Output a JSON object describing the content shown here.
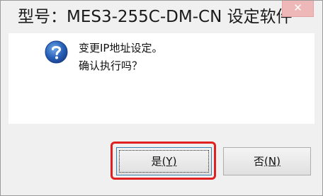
{
  "dialog": {
    "title": "型号：MES3-255C-DM-CN 设定软件",
    "close_glyph": "✕",
    "icon": "question-icon",
    "message_line1": "变更IP地址设定。",
    "message_line2": "确认执行吗？",
    "yes_label": "是",
    "yes_hotkey": "(Y)",
    "no_label": "否",
    "no_hotkey": "(N)",
    "highlight_color": "#e02020"
  }
}
